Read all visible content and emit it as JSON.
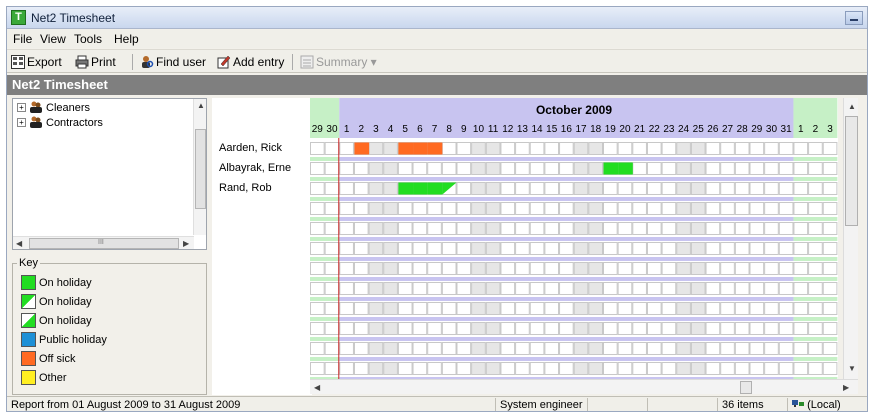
{
  "window": {
    "title": "Net2 Timesheet"
  },
  "menu": [
    "File",
    "View",
    "Tools",
    "Help"
  ],
  "toolbar": {
    "export_label": "Export",
    "print_label": "Print",
    "find_user_label": "Find user",
    "add_entry_label": "Add entry",
    "summary_label": "Summary ▾"
  },
  "header": {
    "title": "Net2 Timesheet"
  },
  "tree": {
    "items": [
      "Cleaners",
      "Contractors"
    ],
    "scroll_h_marker": "III"
  },
  "key": {
    "title": "Key",
    "items": [
      {
        "label": "On holiday",
        "color": "#22dd22",
        "style": "full"
      },
      {
        "label": "On holiday",
        "color": "#22dd22",
        "style": "half-diagonal-first"
      },
      {
        "label": "On holiday",
        "color": "#22dd22",
        "style": "half-diagonal-second"
      },
      {
        "label": "Public holiday",
        "color": "#1e90d6",
        "style": "full"
      },
      {
        "label": "Off sick",
        "color": "#ff6a22",
        "style": "full"
      },
      {
        "label": "Other",
        "color": "#ffee22",
        "style": "full"
      }
    ]
  },
  "timesheet": {
    "month_label": "October 2009",
    "days": [
      "29",
      "30",
      "1",
      "2",
      "3",
      "4",
      "5",
      "6",
      "7",
      "8",
      "9",
      "10",
      "11",
      "12",
      "13",
      "14",
      "15",
      "16",
      "17",
      "18",
      "19",
      "20",
      "21",
      "22",
      "23",
      "24",
      "25",
      "26",
      "27",
      "28",
      "29",
      "30",
      "31",
      "1",
      "2",
      "3"
    ],
    "month_start_index": 2,
    "month_end_index": 32,
    "weekend_indices": [
      4,
      5,
      11,
      12,
      18,
      19,
      25,
      26
    ],
    "people": [
      {
        "name": "Aarden, Rick",
        "entries": [
          {
            "day_index": 3,
            "type": "Off sick",
            "style": "full"
          },
          {
            "day_index": 6,
            "type": "Off sick",
            "style": "full"
          },
          {
            "day_index": 7,
            "type": "Off sick",
            "style": "full"
          },
          {
            "day_index": 8,
            "type": "Off sick",
            "style": "full"
          }
        ]
      },
      {
        "name": "Albayrak, Erne",
        "entries": [
          {
            "day_index": 20,
            "type": "On holiday",
            "style": "full"
          },
          {
            "day_index": 21,
            "type": "On holiday",
            "style": "full"
          }
        ]
      },
      {
        "name": "Rand, Rob",
        "entries": [
          {
            "day_index": 6,
            "type": "On holiday",
            "style": "full"
          },
          {
            "day_index": 7,
            "type": "On holiday",
            "style": "full"
          },
          {
            "day_index": 8,
            "type": "On holiday",
            "style": "full"
          },
          {
            "day_index": 9,
            "type": "On holiday",
            "style": "half-diagonal-first"
          }
        ]
      }
    ],
    "empty_rows": 11
  },
  "status": {
    "report_range": "Report from 01 August 2009 to 31 August 2009",
    "user_role": "System engineer",
    "item_count": "36 items",
    "connection": "(Local)"
  },
  "colors": {
    "month_header": "#c8c4f0",
    "outside_month_header": "#c6f0c6",
    "weekend_cell": "#e6e6e6",
    "separator_row": "#c8c4f0",
    "today_line": "#cc2222"
  }
}
